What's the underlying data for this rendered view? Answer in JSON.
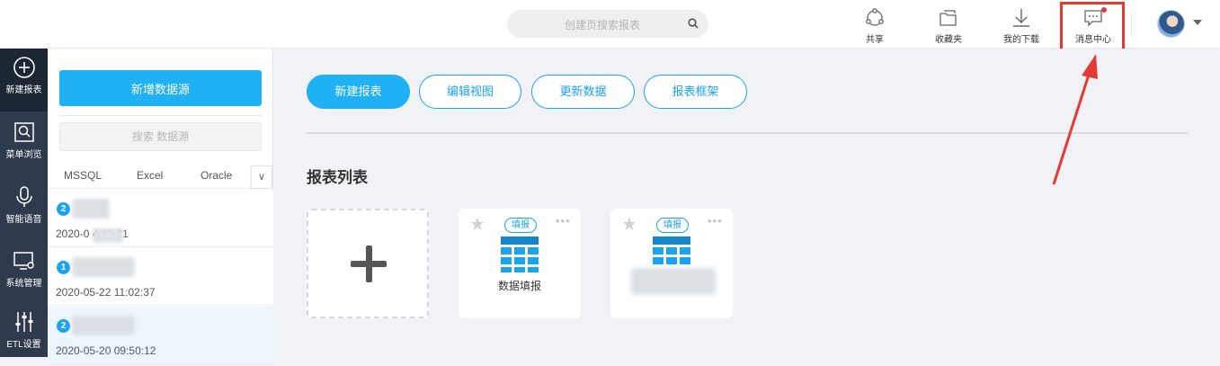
{
  "header": {
    "search_placeholder": "创建页搜索报表",
    "tools": [
      {
        "label": "共享",
        "icon": "share-icon"
      },
      {
        "label": "收藏夹",
        "icon": "favorites-icon"
      },
      {
        "label": "我的下载",
        "icon": "download-icon"
      },
      {
        "label": "消息中心",
        "icon": "message-icon"
      }
    ]
  },
  "nav": [
    {
      "label": "新建报表",
      "icon": "add-circle-icon"
    },
    {
      "label": "菜单浏览",
      "icon": "browse-icon"
    },
    {
      "label": "智能语音",
      "icon": "microphone-icon"
    },
    {
      "label": "系统管理",
      "icon": "system-settings-icon"
    },
    {
      "label": "ETL设置",
      "icon": "sliders-icon"
    }
  ],
  "panel": {
    "add_button": "新增数据源",
    "search_placeholder": "搜索 数据源",
    "tabs": [
      "MSSQL",
      "Excel",
      "Oracle"
    ],
    "more": "∨",
    "items": [
      {
        "badge": "2",
        "time": "2020-0      4:03:21"
      },
      {
        "badge": "1",
        "time": "2020-05-22 11:02:37"
      },
      {
        "badge": "2",
        "time": "2020-05-20 09:50:12"
      }
    ]
  },
  "main": {
    "actions": [
      "新建报表",
      "编辑视图",
      "更新数据",
      "报表框架"
    ],
    "section_title": "报表列表",
    "cards": [
      {
        "tag": "填报",
        "name": "数据填报"
      },
      {
        "tag": "填报",
        "name": ""
      }
    ]
  },
  "colors": {
    "accent": "#1fb0f5",
    "nav_bg": "#2f3b4d",
    "highlight": "#e53935"
  }
}
